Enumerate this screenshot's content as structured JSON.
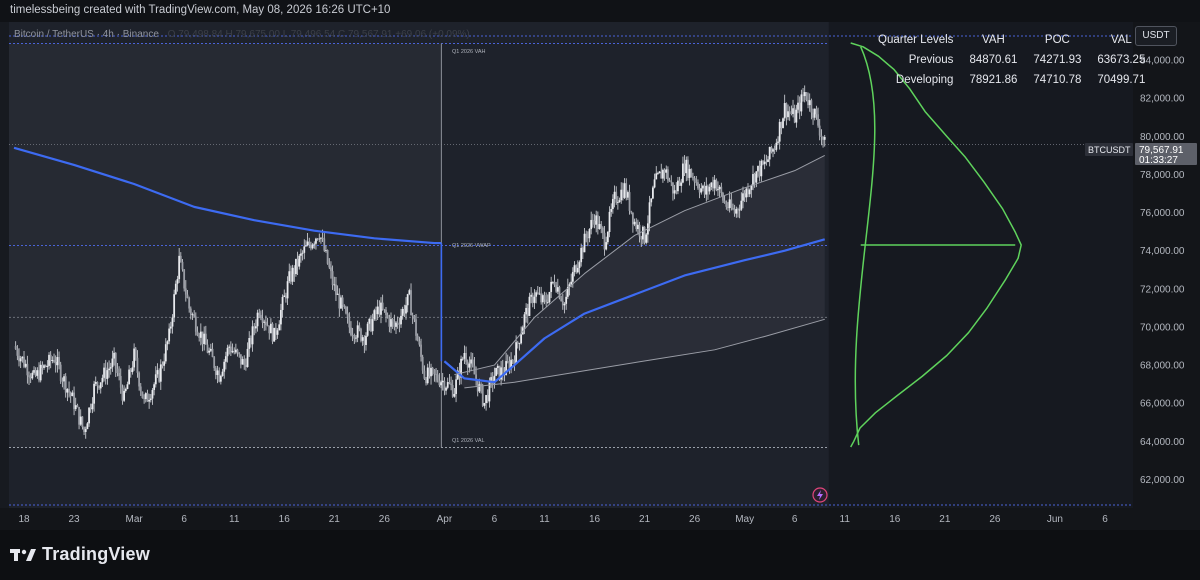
{
  "header": {
    "attribution": "timelessbeing created with TradingView.com, May 08, 2026 16:26 UTC+10"
  },
  "symbol_legend": {
    "title": "Bitcoin / TetherUS · 4h · Binance",
    "ohlc": "O 79,498.84 H 79,675.00 L 79,496.54 C 79,567.91 +69.06 (+0.09%)"
  },
  "currency_button": "USDT",
  "quarter_table": {
    "headers": [
      "Quarter Levels",
      "VAH",
      "POC",
      "VAL"
    ],
    "rows": [
      {
        "label": "Previous",
        "vah": "84870.61",
        "poc": "74271.93",
        "val": "63673.25"
      },
      {
        "label": "Developing",
        "vah": "78921.86",
        "poc": "74710.78",
        "val": "70499.71"
      }
    ]
  },
  "level_labels": {
    "vah": "Q1 2026 VAH",
    "vwap": "Q1 2026 VWAP",
    "val": "Q1 2026 VAL"
  },
  "current_price": {
    "ticker": "BTCUSDT",
    "price": "79,567.91",
    "countdown": "01:33:27"
  },
  "branding": {
    "name": "TradingView"
  },
  "colors": {
    "blue_vwap": "#3d6bf2",
    "profile_green": "#5fd35c",
    "candle": "#d8dbe0",
    "grey_band": "#9a9da6"
  },
  "chart_data": {
    "type": "candlestick",
    "symbol": "BTCUSDT",
    "interval": "4h",
    "ylim": [
      60500,
      86000
    ],
    "price_ticks": [
      "84,000.00",
      "82,000.00",
      "80,000.00",
      "78,000.00",
      "76,000.00",
      "74,000.00",
      "72,000.00",
      "70,000.00",
      "68,000.00",
      "66,000.00",
      "64,000.00",
      "62,000.00"
    ],
    "price_tick_values": [
      84000,
      82000,
      80000,
      78000,
      76000,
      74000,
      72000,
      70000,
      68000,
      66000,
      64000,
      62000
    ],
    "date_ticks": [
      {
        "label": "18",
        "day": -11.0
      },
      {
        "label": "23",
        "day": -6.0
      },
      {
        "label": "Mar",
        "day": 0.0
      },
      {
        "label": "6",
        "day": 5.0
      },
      {
        "label": "11",
        "day": 10.0
      },
      {
        "label": "16",
        "day": 15.0
      },
      {
        "label": "21",
        "day": 20.0
      },
      {
        "label": "26",
        "day": 25.0
      },
      {
        "label": "Apr",
        "day": 31.0
      },
      {
        "label": "6",
        "day": 36.0
      },
      {
        "label": "11",
        "day": 41.0
      },
      {
        "label": "16",
        "day": 46.0
      },
      {
        "label": "21",
        "day": 51.0
      },
      {
        "label": "26",
        "day": 56.0
      },
      {
        "label": "May",
        "day": 61.0
      },
      {
        "label": "6",
        "day": 66.0
      },
      {
        "label": "11",
        "day": 71.0
      },
      {
        "label": "16",
        "day": 76.0
      },
      {
        "label": "21",
        "day": 81.0
      },
      {
        "label": "26",
        "day": 86.0
      },
      {
        "label": "Jun",
        "day": 92.0
      },
      {
        "label": "6",
        "day": 97.0
      }
    ],
    "close_path": [
      [
        -12.0,
        69000
      ],
      [
        -10.0,
        67300
      ],
      [
        -8.0,
        68400
      ],
      [
        -6.0,
        66000
      ],
      [
        -5.0,
        64500
      ],
      [
        -4.0,
        66800
      ],
      [
        -2.0,
        68200
      ],
      [
        -1.0,
        66200
      ],
      [
        0.0,
        68500
      ],
      [
        1.0,
        66000
      ],
      [
        2.5,
        67500
      ],
      [
        3.5,
        69500
      ],
      [
        4.5,
        73500
      ],
      [
        5.5,
        71000
      ],
      [
        7.0,
        69200
      ],
      [
        8.5,
        67500
      ],
      [
        9.5,
        69000
      ],
      [
        11.0,
        68000
      ],
      [
        12.5,
        71000
      ],
      [
        14.0,
        69500
      ],
      [
        15.5,
        72500
      ],
      [
        17.0,
        74000
      ],
      [
        18.5,
        75000
      ],
      [
        20.0,
        72000
      ],
      [
        21.5,
        70000
      ],
      [
        23.0,
        69500
      ],
      [
        24.5,
        71000
      ],
      [
        26.0,
        70000
      ],
      [
        27.5,
        71500
      ],
      [
        29.0,
        67500
      ],
      [
        30.5,
        67300
      ],
      [
        32.0,
        66700
      ],
      [
        33.0,
        68700
      ],
      [
        34.0,
        67500
      ],
      [
        35.0,
        66000
      ],
      [
        36.0,
        67500
      ],
      [
        37.0,
        67700
      ],
      [
        38.0,
        68500
      ],
      [
        39.0,
        70500
      ],
      [
        40.0,
        71800
      ],
      [
        41.0,
        71200
      ],
      [
        42.0,
        72500
      ],
      [
        43.0,
        71200
      ],
      [
        44.0,
        73000
      ],
      [
        45.0,
        74500
      ],
      [
        46.0,
        75800
      ],
      [
        47.0,
        74500
      ],
      [
        48.0,
        76700
      ],
      [
        49.0,
        77300
      ],
      [
        50.0,
        75500
      ],
      [
        51.0,
        74700
      ],
      [
        52.0,
        77500
      ],
      [
        53.0,
        78300
      ],
      [
        54.0,
        77000
      ],
      [
        55.0,
        78500
      ],
      [
        56.0,
        77800
      ],
      [
        57.0,
        77000
      ],
      [
        58.0,
        77700
      ],
      [
        59.0,
        76500
      ],
      [
        60.0,
        76000
      ],
      [
        61.0,
        77000
      ],
      [
        62.0,
        78000
      ],
      [
        63.0,
        78500
      ],
      [
        64.0,
        79500
      ],
      [
        65.0,
        81500
      ],
      [
        66.0,
        81000
      ],
      [
        67.0,
        82300
      ],
      [
        68.0,
        81200
      ],
      [
        69.0,
        79567.91
      ]
    ],
    "profile_curve": [
      [
        84900,
        0
      ],
      [
        84700,
        4
      ],
      [
        84200,
        9
      ],
      [
        83500,
        14
      ],
      [
        82500,
        19
      ],
      [
        81300,
        24
      ],
      [
        80000,
        31
      ],
      [
        78900,
        37
      ],
      [
        77600,
        43
      ],
      [
        76200,
        49
      ],
      [
        75000,
        53
      ],
      [
        74300,
        55
      ],
      [
        73600,
        54
      ],
      [
        72500,
        50
      ],
      [
        71000,
        44
      ],
      [
        69700,
        38
      ],
      [
        68500,
        31
      ],
      [
        67400,
        23
      ],
      [
        66400,
        15
      ],
      [
        65500,
        8
      ],
      [
        64700,
        3
      ],
      [
        64000,
        1
      ],
      [
        63700,
        0
      ]
    ],
    "series": [
      {
        "name": "Q1 2026 VWAP",
        "values": [
          [
            -12,
            79400
          ],
          [
            -6,
            78500
          ],
          [
            0,
            77500
          ],
          [
            6,
            76300
          ],
          [
            12,
            75600
          ],
          [
            18,
            75050
          ],
          [
            24,
            74650
          ],
          [
            30,
            74400
          ],
          [
            30.7,
            74400
          ]
        ]
      },
      {
        "name": "Q2 2026 VWAP",
        "values": [
          [
            31,
            68200
          ],
          [
            33,
            67300
          ],
          [
            36,
            67100
          ],
          [
            38,
            68000
          ],
          [
            41,
            69400
          ],
          [
            45,
            70700
          ],
          [
            50,
            71700
          ],
          [
            55,
            72700
          ],
          [
            61,
            73500
          ],
          [
            65,
            74000
          ],
          [
            69,
            74600
          ]
        ]
      },
      {
        "name": "Q1 2026 VAH",
        "values": [
          [
            -12,
            84870.61
          ],
          [
            30.7,
            84870.61
          ]
        ]
      },
      {
        "name": "Q1 2026 VAL",
        "values": [
          [
            -12,
            63673.25
          ],
          [
            30.7,
            63673.25
          ]
        ]
      },
      {
        "name": "Q2 2026 VAH band",
        "values": [
          [
            32,
            67500
          ],
          [
            36,
            68000
          ],
          [
            40,
            70500
          ],
          [
            45,
            72800
          ],
          [
            50,
            74800
          ],
          [
            55,
            76100
          ],
          [
            61,
            77300
          ],
          [
            66,
            78200
          ],
          [
            69,
            79000
          ]
        ]
      },
      {
        "name": "Q2 2026 VAL band",
        "values": [
          [
            33,
            66800
          ],
          [
            38,
            67100
          ],
          [
            45,
            67700
          ],
          [
            52,
            68300
          ],
          [
            58,
            68800
          ],
          [
            63,
            69500
          ],
          [
            69,
            70400
          ]
        ]
      }
    ],
    "reference_levels": [
      {
        "name": "Q1 2026 VAH",
        "value": 84870.61
      },
      {
        "name": "Q1 2026 VWAP",
        "value": 74271.93
      },
      {
        "name": "Q1 2026 VAL",
        "value": 63673.25
      },
      {
        "name": "Developing VAL",
        "value": 70499.71
      },
      {
        "name": "Current price",
        "value": 79567.91
      }
    ]
  }
}
